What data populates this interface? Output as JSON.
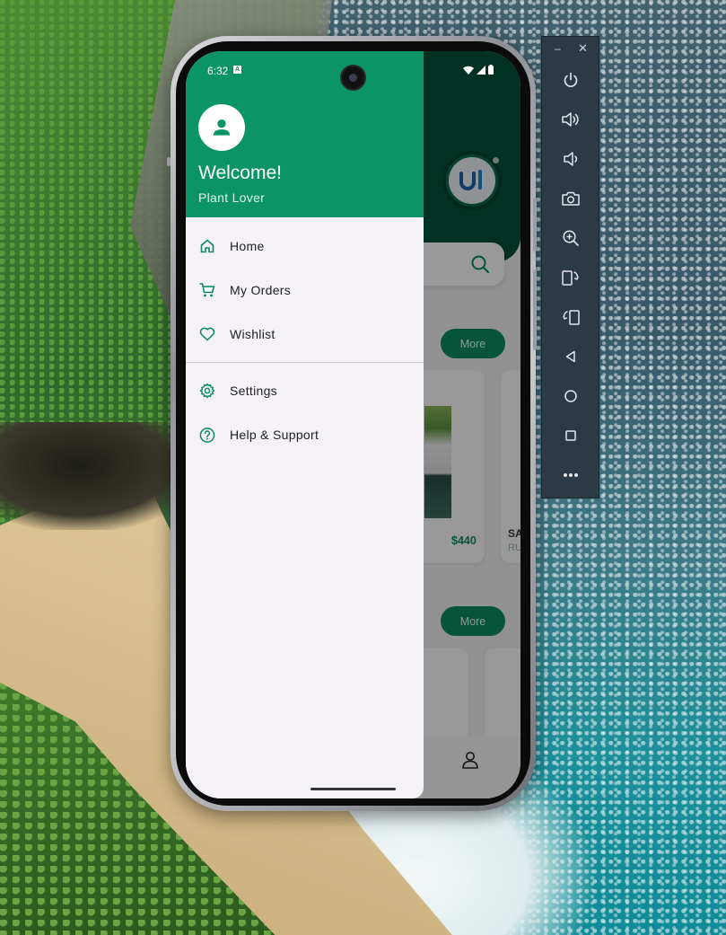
{
  "status_bar": {
    "time": "6:32",
    "notification_badge": "A"
  },
  "drawer": {
    "welcome_title": "Welcome!",
    "welcome_subtitle": "Plant Lover",
    "menu_items": [
      {
        "label": "Home",
        "icon": "home-icon"
      },
      {
        "label": "My Orders",
        "icon": "cart-icon"
      },
      {
        "label": "Wishlist",
        "icon": "heart-icon"
      },
      {
        "label": "Settings",
        "icon": "gear-icon"
      },
      {
        "label": "Help & Support",
        "icon": "help-icon"
      }
    ]
  },
  "app": {
    "more_label": "More",
    "price": "$440",
    "cut_label": "SA",
    "cut_label_sub": "RU"
  },
  "emulator": {
    "minimize": "–",
    "close": "✕",
    "buttons": [
      "power-icon",
      "volume-up-icon",
      "volume-down-icon",
      "camera-icon",
      "zoom-icon",
      "rotate-left-icon",
      "rotate-right-icon",
      "back-icon",
      "home-icon",
      "overview-icon",
      "more-icon"
    ]
  },
  "colors": {
    "brand_green": "#0b9566",
    "dark_green": "#004f37",
    "drawer_bg": "#f4f1f7",
    "toolbar_bg": "#2b3a44"
  }
}
